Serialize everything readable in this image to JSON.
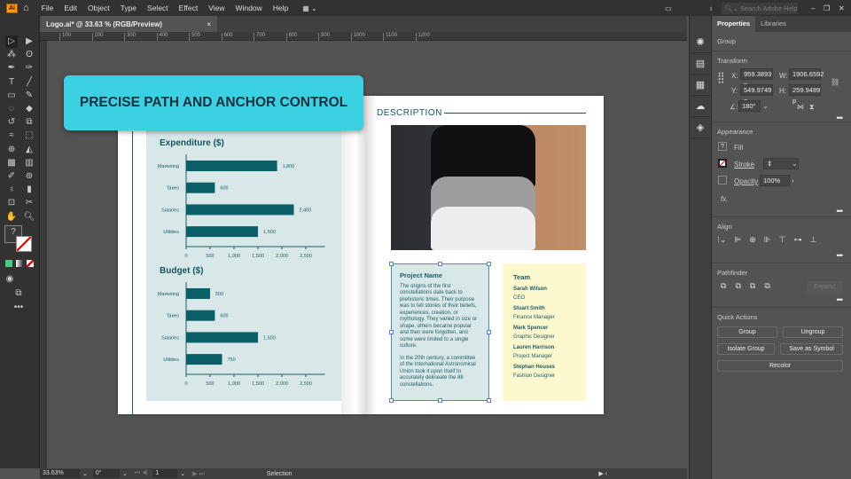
{
  "app": {
    "logo": "Ai",
    "menus": [
      "File",
      "Edit",
      "Object",
      "Type",
      "Select",
      "Effect",
      "View",
      "Window",
      "Help"
    ],
    "search_placeholder": "Search Adobe Help"
  },
  "document_tab": {
    "title": "Logo.ai* @ 33.63 % (RGB/Preview)",
    "close": "×"
  },
  "ruler": [
    "100",
    "200",
    "300",
    "400",
    "500",
    "600",
    "700",
    "800",
    "900",
    "1000",
    "1100",
    "1200"
  ],
  "status": {
    "zoom": "33.63%",
    "rotation": "0°",
    "artboard": "1",
    "tool": "Selection"
  },
  "panel": {
    "tabs": [
      "Properties",
      "Libraries"
    ],
    "selection": "Group",
    "transform": {
      "title": "Transform",
      "x_label": "X:",
      "x": "959.3893 p",
      "y_label": "Y:",
      "y": "549.9749 p",
      "w_label": "W:",
      "w": "1906.6592",
      "h_label": "H:",
      "h": "259.9489 p",
      "angle": "180°"
    },
    "appearance": {
      "title": "Appearance",
      "fill": "Fill",
      "stroke": "Stroke",
      "opacity_label": "Opacity",
      "opacity": "100%",
      "fx": "fx."
    },
    "align": {
      "title": "Align"
    },
    "pathfinder": {
      "title": "Pathfinder",
      "expand": "Expand"
    },
    "quick_actions": {
      "title": "Quick Actions",
      "group": "Group",
      "ungroup": "Ungroup",
      "isolate": "Isolate Group",
      "save_symbol": "Save as Symbol",
      "recolor": "Recolor"
    }
  },
  "callout": "PRECISE PATH AND ANCHOR CONTROL",
  "page": {
    "description_heading": "DESCRIPTION",
    "project": {
      "title": "Project Name",
      "p1": "The origins of the first constellations date back to prehistoric times. Their purpose was to tell stories of their beliefs, experiences, creation, or mythology.  They varied in size or shape, others became popular and then were forgotten, and some were limited to a single culture.",
      "p2": "In the 20th century, a committee of the International Astronomical Union took it upon itself to accurately delineate the 88 constellations."
    },
    "team": {
      "title": "Team",
      "members": [
        {
          "name": "Sarah Wilson",
          "role": "CEO"
        },
        {
          "name": "Stuart Smith",
          "role": "Finance Manager"
        },
        {
          "name": "Mark Spencer",
          "role": "Graphic Designer"
        },
        {
          "name": "Lauren Harrison",
          "role": "Project Manager"
        },
        {
          "name": "Stephan Houses",
          "role": "Fashion Designer"
        }
      ]
    }
  },
  "colors": {
    "bar": "#0b5f66",
    "accent": "#3ad2e2",
    "selection": "#4a86e8"
  },
  "chart_data": [
    {
      "type": "bar",
      "title": "Expenditure ($)",
      "categories": [
        "Marketing",
        "Taxes",
        "Salaries",
        "Utilities"
      ],
      "values": [
        1900,
        600,
        2250,
        1500
      ],
      "labels": [
        "1,800",
        "600",
        "2,400",
        "1,500"
      ],
      "xticks": [
        "0",
        "500",
        "1,000",
        "1,500",
        "2,000",
        "2,500"
      ],
      "xlim": [
        0,
        2900
      ]
    },
    {
      "type": "bar",
      "title": "Budget ($)",
      "categories": [
        "Marketing",
        "Taxes",
        "Salaries",
        "Utilities"
      ],
      "values": [
        500,
        600,
        1500,
        750
      ],
      "labels": [
        "500",
        "600",
        "1,500",
        "750"
      ],
      "xticks": [
        "0",
        "500",
        "1,000",
        "1,500",
        "2,000",
        "2,500"
      ],
      "xlim": [
        0,
        2900
      ]
    }
  ]
}
